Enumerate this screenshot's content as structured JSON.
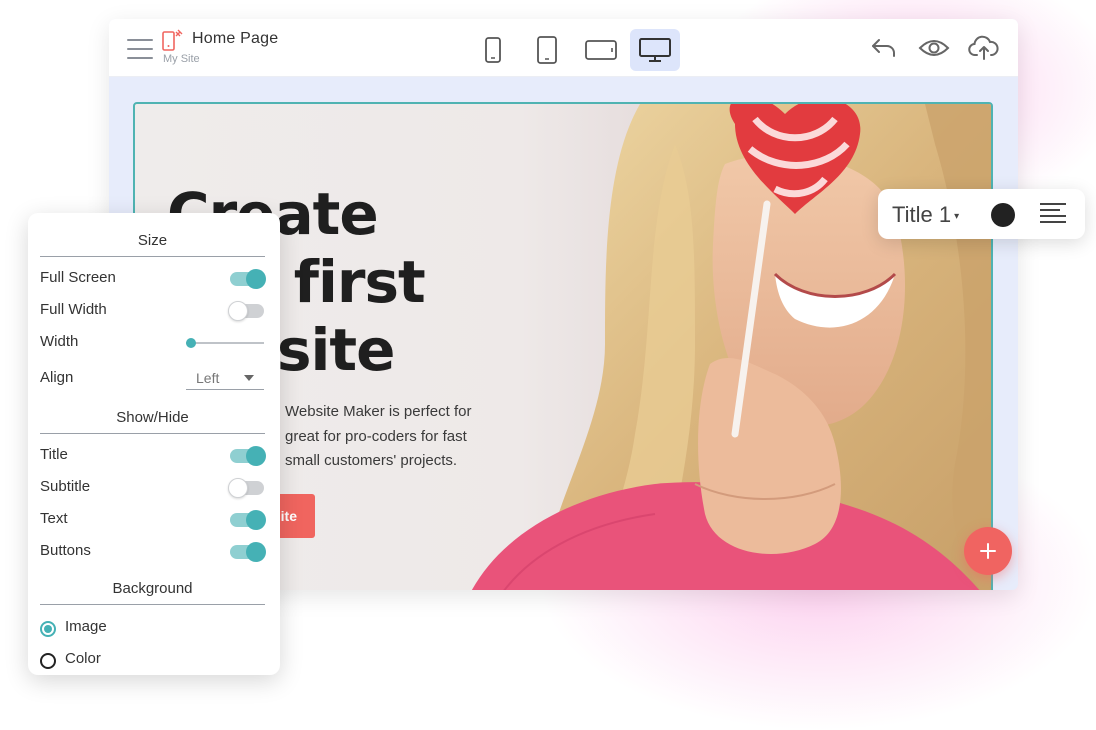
{
  "header": {
    "page_title": "Home Page",
    "site_name": "My Site",
    "devices": [
      "phone-small-icon",
      "phone-icon",
      "tablet-icon",
      "desktop-icon"
    ],
    "active_device": "desktop-icon",
    "actions": [
      "undo-icon",
      "preview-eye-icon",
      "publish-cloud-icon"
    ]
  },
  "hero": {
    "title_lines": [
      "Create",
      "r first",
      "site"
    ],
    "text_lines": [
      "Website Maker is perfect for",
      "great for pro-coders for fast",
      "small customers' projects."
    ],
    "button_label": "ite"
  },
  "title_toolbar": {
    "style_label": "Title 1",
    "text_color": "#222222"
  },
  "panel": {
    "size_heading": "Size",
    "full_screen_label": "Full Screen",
    "full_screen_on": true,
    "full_width_label": "Full Width",
    "full_width_on": false,
    "width_label": "Width",
    "align_label": "Align",
    "align_value": "Left",
    "show_hide_heading": "Show/Hide",
    "title_label": "Title",
    "title_on": true,
    "subtitle_label": "Subtitle",
    "subtitle_on": false,
    "text_label": "Text",
    "text_on": true,
    "buttons_label": "Buttons",
    "buttons_on": true,
    "background_heading": "Background",
    "image_label": "Image",
    "color_label": "Color",
    "background_selected": "Image"
  },
  "colors": {
    "accent_teal": "#45b1b5",
    "button_red": "#f0655f",
    "active_device_bg": "#dde5fb"
  }
}
